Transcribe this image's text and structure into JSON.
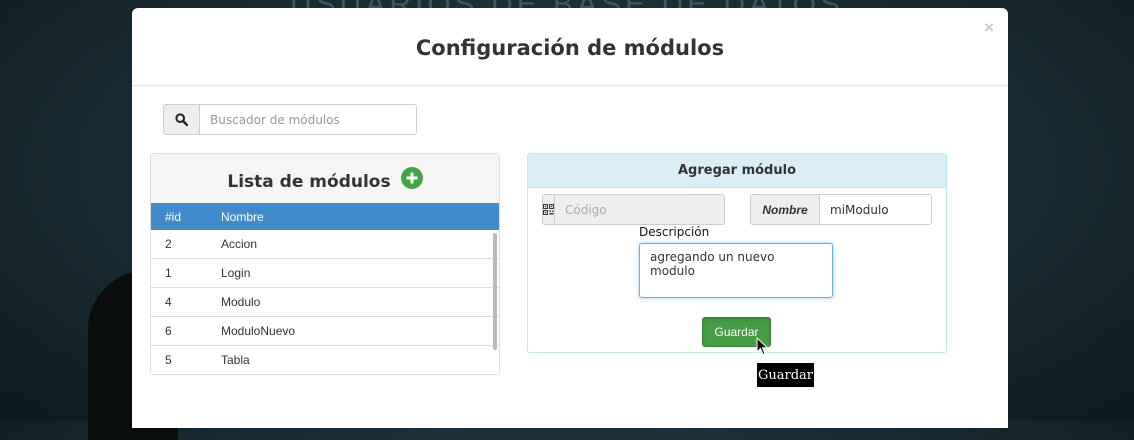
{
  "background": {
    "title": "USUARIOS DE BASE DE DATOS"
  },
  "modal": {
    "title": "Configuración de módulos",
    "close_glyph": "×"
  },
  "search": {
    "placeholder": "Buscador de módulos",
    "icon": "search-icon"
  },
  "list": {
    "title": "Lista de módulos",
    "add_icon": "plus-circle-icon",
    "headers": [
      "#id",
      "Nombre"
    ],
    "rows": [
      {
        "id": "2",
        "name": "Accion"
      },
      {
        "id": "1",
        "name": "Login"
      },
      {
        "id": "4",
        "name": "Modulo"
      },
      {
        "id": "6",
        "name": "ModuloNuevo"
      },
      {
        "id": "5",
        "name": "Tabla"
      }
    ]
  },
  "form": {
    "title": "Agregar módulo",
    "code_placeholder": "Código",
    "code_icon": "qrcode-icon",
    "name_label": "Nombre",
    "name_value": "miModulo",
    "desc_label": "Descripción",
    "desc_value": "agregando un nuevo modulo",
    "save_label": "Guardar"
  },
  "tooltip": {
    "text": "Guardar"
  },
  "colors": {
    "primary": "#428bca",
    "success": "#449d44",
    "info_bg": "#d9edf7",
    "info_border": "#bce8f1"
  }
}
